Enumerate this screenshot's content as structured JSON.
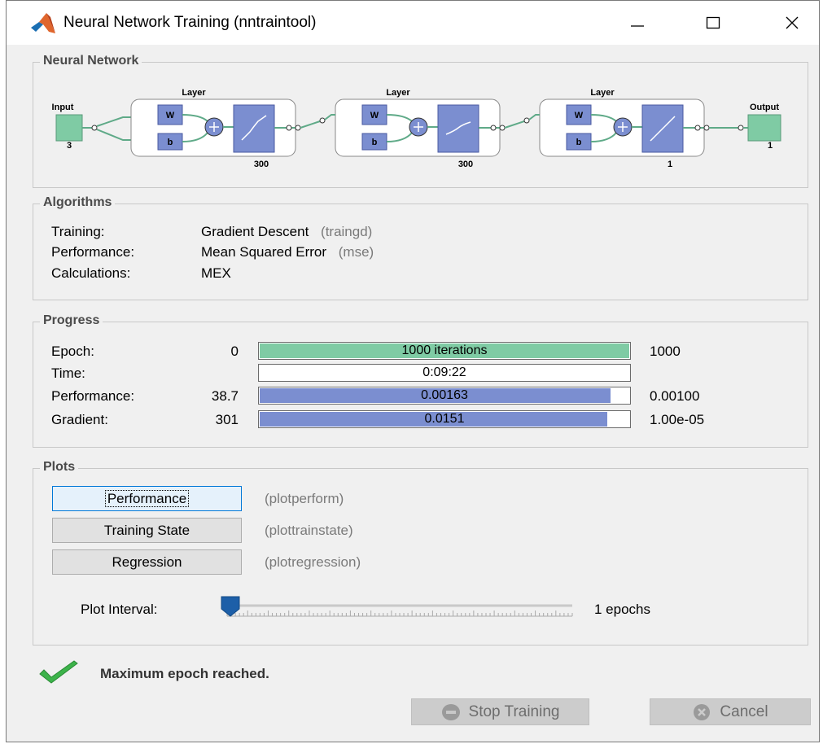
{
  "window": {
    "title": "Neural Network Training (nntraintool)"
  },
  "network": {
    "section_label": "Neural Network",
    "input_label": "Input",
    "input_size": "3",
    "output_label": "Output",
    "output_size": "1",
    "layers": [
      {
        "label": "Layer",
        "w": "W",
        "b": "b",
        "size": "300"
      },
      {
        "label": "Layer",
        "w": "W",
        "b": "b",
        "size": "300"
      },
      {
        "label": "Layer",
        "w": "W",
        "b": "b",
        "size": "1"
      }
    ]
  },
  "algorithms": {
    "section_label": "Algorithms",
    "rows": [
      {
        "key": "Training:",
        "value": "Gradient Descent",
        "code": "(traingd)"
      },
      {
        "key": "Performance:",
        "value": "Mean Squared Error",
        "code": "(mse)"
      },
      {
        "key": "Calculations:",
        "value": "MEX",
        "code": ""
      }
    ]
  },
  "progress": {
    "section_label": "Progress",
    "rows": [
      {
        "key": "Epoch:",
        "start": "0",
        "bar_text": "1000 iterations",
        "end": "1000",
        "fill_fraction": 1.0,
        "fill_color": "#7fcba4"
      },
      {
        "key": "Time:",
        "start": "",
        "bar_text": "0:09:22",
        "end": "",
        "fill_fraction": 0.0,
        "fill_color": "#ffffff"
      },
      {
        "key": "Performance:",
        "start": "38.7",
        "bar_text": "0.00163",
        "end": "0.00100",
        "fill_fraction": 0.95,
        "fill_color": "#7b8ed0"
      },
      {
        "key": "Gradient:",
        "start": "301",
        "bar_text": "0.0151",
        "end": "1.00e-05",
        "fill_fraction": 0.94,
        "fill_color": "#7b8ed0"
      }
    ]
  },
  "plots": {
    "section_label": "Plots",
    "buttons": [
      {
        "label": "Performance",
        "code": "(plotperform)"
      },
      {
        "label": "Training State",
        "code": "(plottrainstate)"
      },
      {
        "label": "Regression",
        "code": "(plotregression)"
      }
    ],
    "interval_label": "Plot Interval:",
    "interval_value": "1 epochs"
  },
  "status": {
    "message": "Maximum epoch reached."
  },
  "footer": {
    "stop_label": "Stop Training",
    "cancel_label": "Cancel"
  },
  "colors": {
    "accent_green": "#7fcba4",
    "bar_blue": "#7b8ed0",
    "check_green": "#3cb34a",
    "matlab_orange": "#e0662d"
  }
}
